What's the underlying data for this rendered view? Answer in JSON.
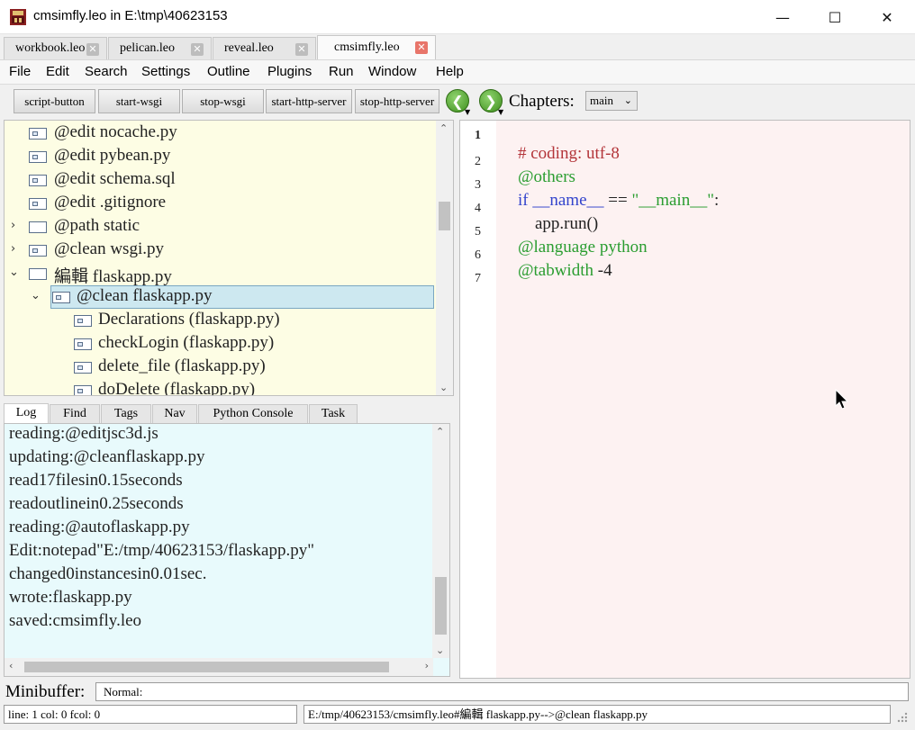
{
  "window": {
    "title": "cmsimfly.leo in E:\\tmp\\40623153",
    "minimize_glyph": "—",
    "maximize_glyph": "☐",
    "close_glyph": "✕"
  },
  "tabs": [
    {
      "label": "workbook.leo",
      "active": false
    },
    {
      "label": "pelican.leo",
      "active": false
    },
    {
      "label": "reveal.leo",
      "active": false
    },
    {
      "label": "cmsimfly.leo",
      "active": true
    }
  ],
  "tab_close_glyph": "✕",
  "menu": [
    "File",
    "Edit",
    "Search",
    "Settings",
    "Outline",
    "Plugins",
    "Run",
    "Window",
    "Help"
  ],
  "toolbar": {
    "buttons": [
      "script-button",
      "start-wsgi",
      "stop-wsgi",
      "start-http-server",
      "stop-http-server"
    ],
    "back_glyph": "❮",
    "forward_glyph": "❯",
    "caret_glyph": "▼",
    "chapters_label": "Chapters:",
    "chapters_value": "main",
    "chapters_chevron": "⌄"
  },
  "outline": {
    "nodes": [
      {
        "label": "@edit nocache.py",
        "expander": "",
        "icon": "file"
      },
      {
        "label": "@edit pybean.py",
        "expander": "",
        "icon": "file"
      },
      {
        "label": "@edit schema.sql",
        "expander": "",
        "icon": "file"
      },
      {
        "label": "@edit .gitignore",
        "expander": "",
        "icon": "file"
      },
      {
        "label": "@path static",
        "expander": "›",
        "icon": "plain"
      },
      {
        "label": "@clean wsgi.py",
        "expander": "›",
        "icon": "file"
      },
      {
        "label": "編輯 flaskapp.py",
        "expander": "⌄",
        "icon": "plain"
      },
      {
        "label": "@clean flaskapp.py",
        "expander": "⌄",
        "icon": "file",
        "selected": true
      },
      {
        "label": "Declarations (flaskapp.py)",
        "expander": "",
        "icon": "file"
      },
      {
        "label": "checkLogin (flaskapp.py)",
        "expander": "",
        "icon": "file"
      },
      {
        "label": "delete_file (flaskapp.py)",
        "expander": "",
        "icon": "file"
      },
      {
        "label": "doDelete (flaskapp.py)",
        "expander": "",
        "icon": "file"
      }
    ],
    "scroll_up": "⌃",
    "scroll_down": "⌄"
  },
  "log_tabs": [
    "Log",
    "Find",
    "Tags",
    "Nav",
    "Python Console",
    "Task"
  ],
  "log": {
    "lines": [
      "reading:@editjsc3d.js",
      "updating:@cleanflaskapp.py",
      "read17filesin0.15seconds",
      "readoutlinein0.25seconds",
      "reading:@autoflaskapp.py",
      "Edit:notepad\"E:/tmp/40623153/flaskapp.py\"",
      "changed0instancesin0.01sec.",
      "wrote:flaskapp.py",
      "saved:cmsimfly.leo"
    ],
    "scroll_left": "‹",
    "scroll_right": "›"
  },
  "editor": {
    "line_numbers": [
      "1",
      "2",
      "3",
      "4",
      "5",
      "6",
      "7"
    ],
    "current_line": 1,
    "lines": [
      [
        {
          "t": "# coding: utf-8",
          "c": "comment"
        }
      ],
      [
        {
          "t": "@others",
          "c": "directive"
        }
      ],
      [
        {
          "t": "if ",
          "c": "keyword"
        },
        {
          "t": "__name__",
          "c": "keyword"
        },
        {
          "t": " == ",
          "c": "text"
        },
        {
          "t": "\"__main__\"",
          "c": "string"
        },
        {
          "t": ":",
          "c": "text"
        }
      ],
      [
        {
          "t": "    app.run()",
          "c": "text"
        }
      ],
      [
        {
          "t": "@language python",
          "c": "directive"
        }
      ],
      [
        {
          "t": "@tabwidth",
          "c": "directive"
        },
        {
          "t": " -4",
          "c": "text"
        }
      ],
      []
    ],
    "colors": {
      "comment": "#b3353a",
      "directive": "#2a9d30",
      "keyword": "#3344cc",
      "string": "#2a9d30",
      "text": "#222222"
    }
  },
  "minibuffer": {
    "label": "Minibuffer:",
    "value": "Normal:"
  },
  "status": {
    "left": "line: 1 col: 0 fcol: 0",
    "right": "E:/tmp/40623153/cmsimfly.leo#編輯 flaskapp.py-->@clean flaskapp.py"
  }
}
